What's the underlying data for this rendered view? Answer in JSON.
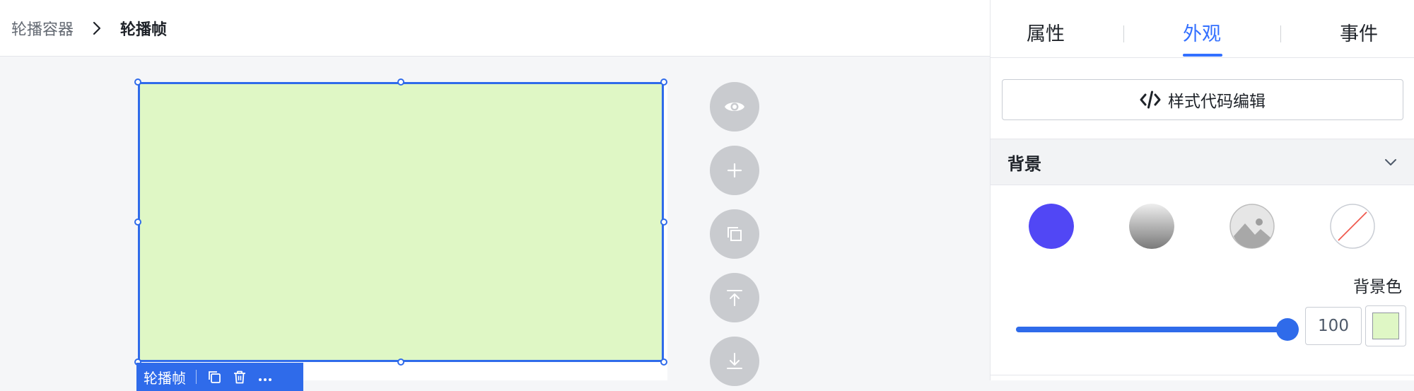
{
  "breadcrumb": {
    "parent": "轮播容器",
    "current": "轮播帧"
  },
  "frame": {
    "fill_color": "#dff7c5",
    "accent_color": "#2f6bea",
    "tag_label": "轮播帧",
    "tag_icons": [
      "copy-icon",
      "trash-icon",
      "more-icon"
    ]
  },
  "tools": [
    "eye-icon",
    "plus-icon",
    "duplicate-icon",
    "move-up-icon",
    "move-down-icon"
  ],
  "panel": {
    "tabs": [
      {
        "label": "属性"
      },
      {
        "label": "外观"
      },
      {
        "label": "事件"
      }
    ],
    "active_tab": "外观",
    "style_code_button": "样式代码编辑",
    "background_section": {
      "title": "背景",
      "options": [
        "solid-color-icon",
        "gradient-icon",
        "image-icon",
        "none-icon"
      ],
      "selected_option_color": "#5147f5",
      "color_label": "背景色",
      "opacity_value": "100",
      "opacity_fraction": 1.0,
      "color_value": "#dff7c5"
    }
  }
}
